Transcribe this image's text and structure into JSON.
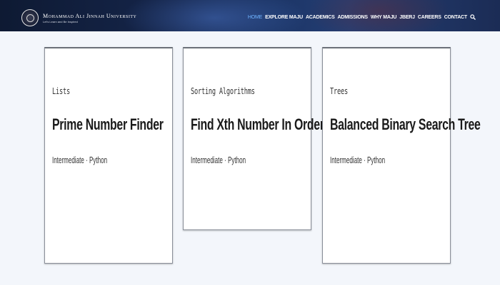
{
  "header": {
    "university_name": "Mohammad Ali Jinnah University",
    "tagline": "Let's Learn and Be Inspired",
    "nav": [
      "HOME",
      "EXPLORE MAJU",
      "ACADEMICS",
      "ADMISSIONS",
      "WHY MAJU",
      "JBERJ",
      "CAREERS",
      "CONTACT"
    ],
    "search_icon": "search-icon",
    "active_color": "#6fb3ff"
  },
  "cards": [
    {
      "category": "Lists",
      "title": "Prime Number Finder",
      "meta": "Intermediate · Python"
    },
    {
      "category": "Sorting Algorithms",
      "title": "Find Xth Number In Order",
      "meta": "Intermediate · Python"
    },
    {
      "category": "Trees",
      "title": "Balanced Binary Search Tree",
      "meta": "Intermediate · Python"
    }
  ]
}
